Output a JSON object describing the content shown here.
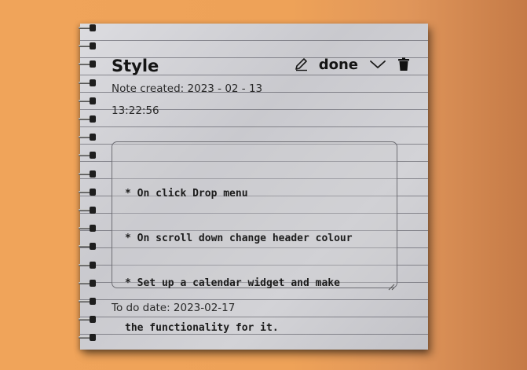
{
  "note": {
    "title": "Style",
    "status_label": "done",
    "created_label": "Note created: 2023 - 02 - 13",
    "created_time": "13:22:56",
    "content_lines": [
      "* On click Drop menu",
      "* On scroll down change header colour",
      "* Set up a calendar widget and make",
      "the functionality for it."
    ],
    "todo_date": "To do date: 2023-02-17"
  },
  "icons": {
    "edit": "pencil-icon",
    "dropdown": "chevron-down-icon",
    "delete": "trash-icon"
  },
  "colors": {
    "background": "#eea258",
    "paper": "#cfcfd2",
    "text": "#141414"
  }
}
